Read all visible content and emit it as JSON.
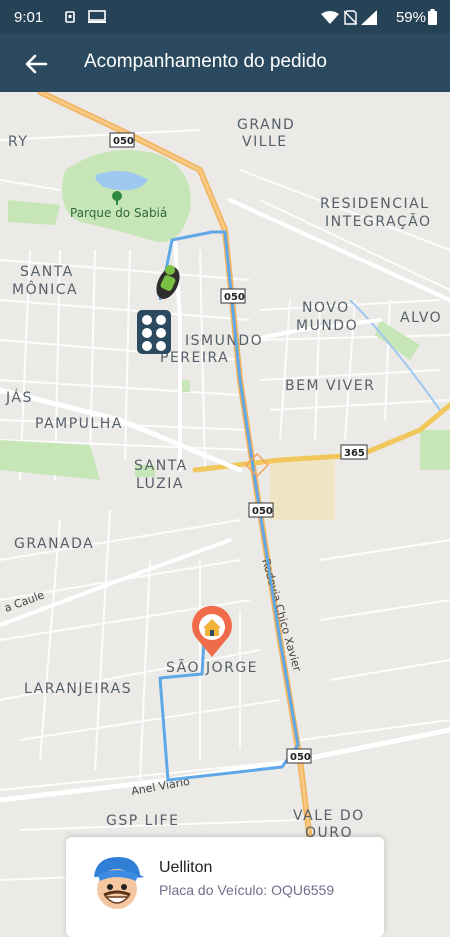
{
  "status_bar": {
    "time": "9:01",
    "battery": "59%"
  },
  "app_bar": {
    "title": "Acompanhamento do pedido"
  },
  "map": {
    "neighborhoods": [
      "GRAND",
      "VILLE",
      "RESIDENCIAL",
      "INTEGRAÇÃO",
      "SANTA",
      "MÔNICA",
      "NOVO",
      "MUNDO",
      "ALVO",
      "ISMUNDO",
      "PEREIRA",
      "BEM VIVER",
      "JÁS",
      "PAMPULHA",
      "SANTA",
      "LUZIA",
      "GRANADA",
      "SÃO JORGE",
      "LARANJEIRAS",
      "GSP LIFE",
      "VALE DO",
      "OURO",
      "RY"
    ],
    "park": "Parque do Sabiá",
    "roads": [
      "Rodovia Chico Xavier",
      "Anel Viário",
      "a Caule"
    ],
    "shields": [
      "050",
      "050",
      "365",
      "050",
      "050"
    ]
  },
  "driver": {
    "name": "Uelliton",
    "plate": "Placa do Veículo: OQU6559"
  }
}
